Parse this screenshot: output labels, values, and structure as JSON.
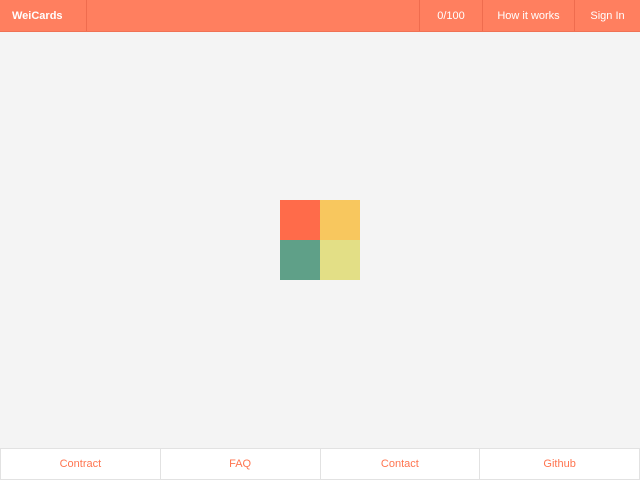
{
  "header": {
    "brand": "WeiCards",
    "count": "0/100",
    "how_it_works": "How it works",
    "sign_in": "Sign In"
  },
  "logo": {
    "tiles": [
      "#ff6b4a",
      "#f8c75e",
      "#5fa088",
      "#e3df86"
    ]
  },
  "footer": {
    "links": [
      "Contract",
      "FAQ",
      "Contact",
      "Github"
    ]
  },
  "colors": {
    "accent": "#ff7f5f",
    "background": "#f4f4f4",
    "link": "#ff7550"
  }
}
